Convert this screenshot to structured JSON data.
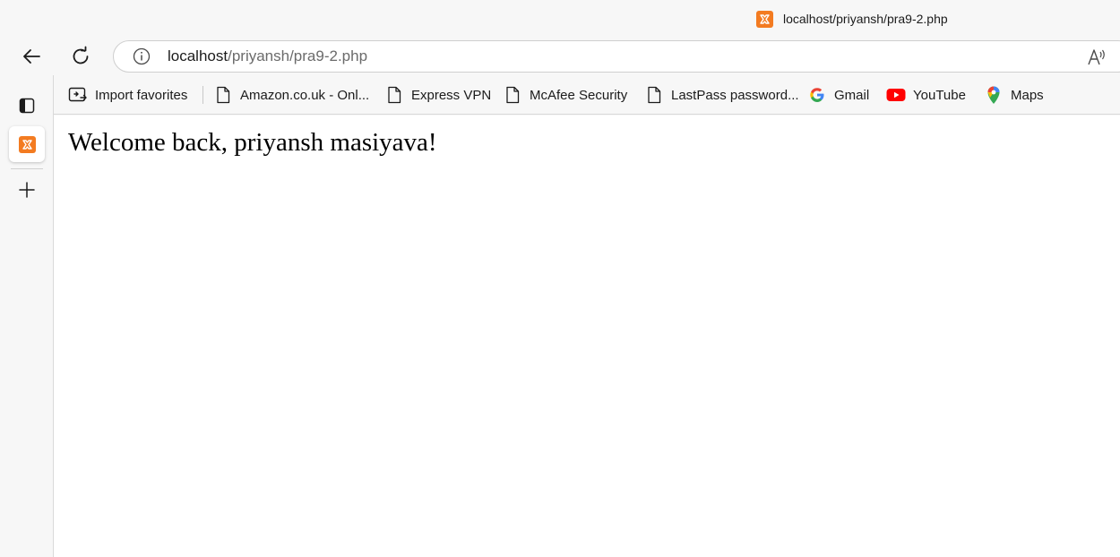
{
  "window": {
    "tab_title": "localhost/priyansh/pra9-2.php",
    "tab_icon": "xampp-icon"
  },
  "navigation": {
    "back_icon": "back-arrow-icon",
    "refresh_icon": "refresh-icon",
    "address": {
      "host": "localhost",
      "path": "/priyansh/pra9-2.php",
      "info_icon": "info-icon",
      "read_aloud_icon": "read-aloud-icon"
    }
  },
  "sidebar": {
    "items": [
      {
        "name": "tab-actions",
        "icon": "tab-actions-icon"
      },
      {
        "name": "active-tab",
        "icon": "xampp-icon"
      },
      {
        "name": "new-tab",
        "icon": "plus-icon"
      }
    ]
  },
  "favorites": [
    {
      "label": "Import favorites",
      "icon": "import-favorites-icon"
    },
    {
      "label": "Amazon.co.uk - Onl...",
      "icon": "page-icon"
    },
    {
      "label": "Express VPN",
      "icon": "page-icon"
    },
    {
      "label": "McAfee Security",
      "icon": "page-icon"
    },
    {
      "label": "LastPass password...",
      "icon": "page-icon"
    },
    {
      "label": "Gmail",
      "icon": "google-icon"
    },
    {
      "label": "YouTube",
      "icon": "youtube-icon"
    },
    {
      "label": "Maps",
      "icon": "maps-pin-icon"
    }
  ],
  "page": {
    "welcome_text": "Welcome back, priyansh masiyava!"
  },
  "colors": {
    "xampp_orange": "#f37b21",
    "youtube_red": "#ff0000",
    "chrome_background": "#f7f7f7"
  }
}
